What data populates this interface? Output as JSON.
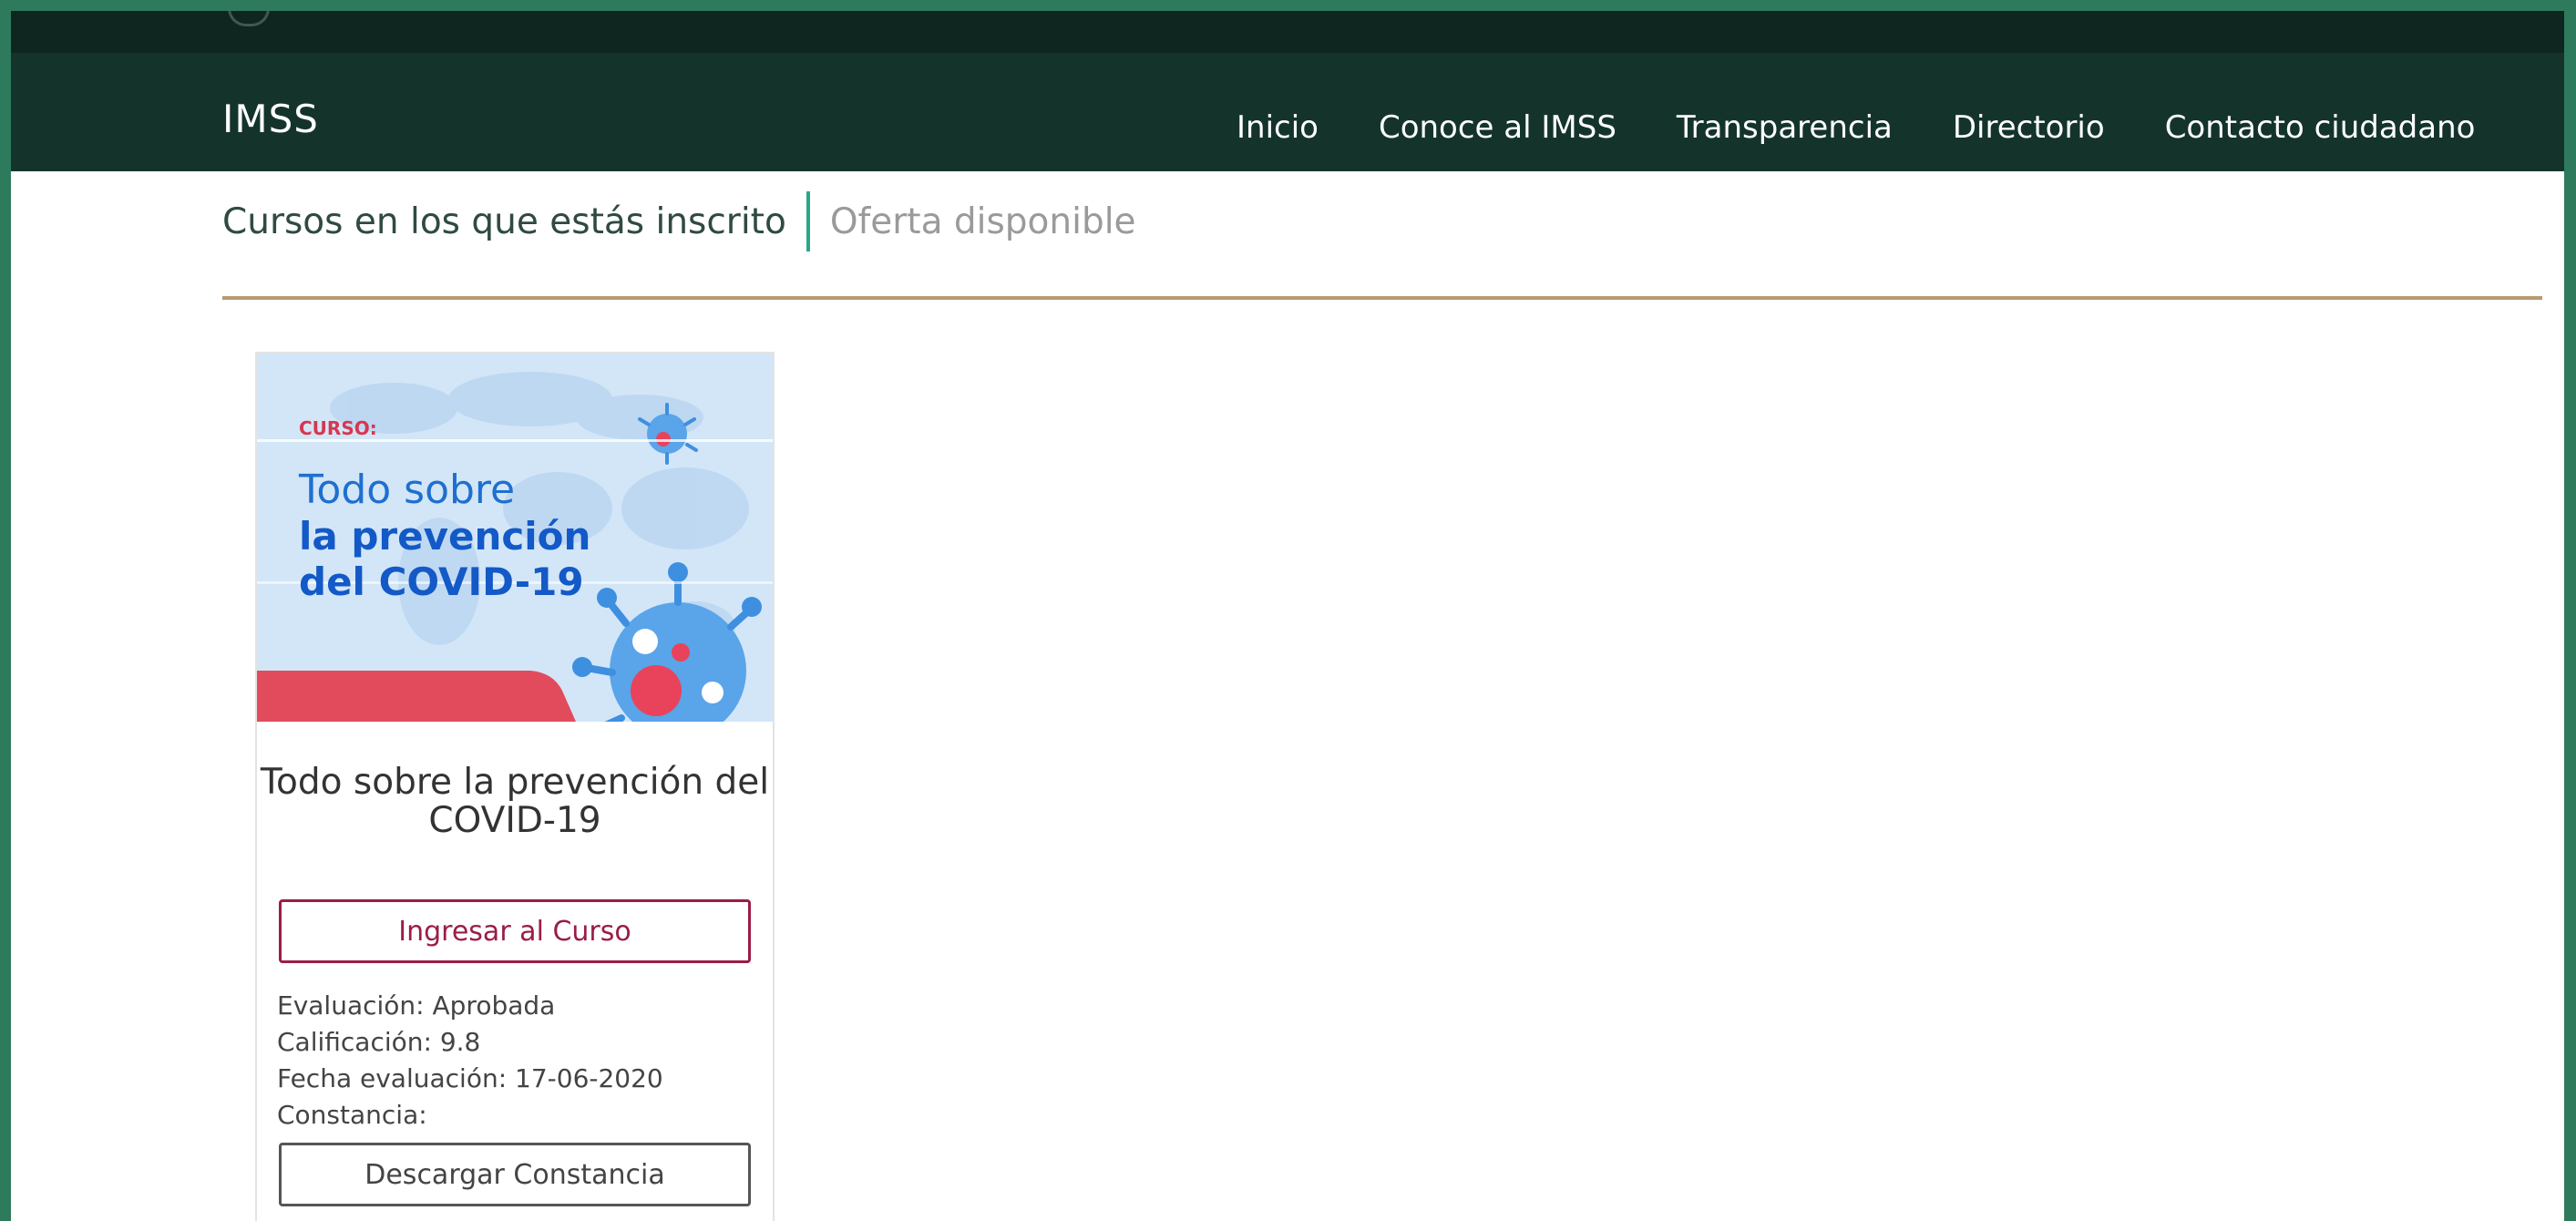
{
  "header": {
    "brand": "IMSS",
    "nav": [
      "Inicio",
      "Conoce al IMSS",
      "Transparencia",
      "Directorio",
      "Contacto ciudadano"
    ]
  },
  "tabs": {
    "enrolled": "Cursos en los que estás inscrito",
    "available": "Oferta disponible"
  },
  "course": {
    "banner": {
      "kicker": "CURSO:",
      "line1": "Todo sobre",
      "line2": "la prevención",
      "line3": "del COVID-19"
    },
    "title": "Todo sobre la prevención del COVID-19",
    "enter_button": "Ingresar al Curso",
    "evaluation": "Evaluación: Aprobada",
    "grade": "Calificación: 9.8",
    "date": "Fecha evaluación: 17-06-2020",
    "certificate": "Constancia:",
    "download_button": "Descargar Constancia"
  },
  "colors": {
    "page_frame": "#2e7a5d",
    "navbar": "#14342b",
    "accent_tab": "#2aa886",
    "gold_rule": "#b79a6e",
    "primary_button": "#9b1c48"
  }
}
